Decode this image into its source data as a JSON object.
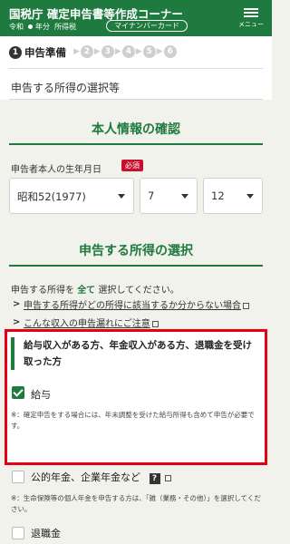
{
  "header": {
    "title": "国税庁 確定申告書等作成コーナー",
    "era": "令和",
    "year_suffix": "年分",
    "tax_type": "所得税",
    "mynumber_button": "マイナンバーカード",
    "menu_label": "メニュー"
  },
  "steps": {
    "current_number": "1",
    "current_label": "申告準備",
    "pending": [
      "2",
      "3",
      "4",
      "5",
      "6"
    ]
  },
  "page_heading": "申告する所得の選択等",
  "personal": {
    "section_title": "本人情報の確認",
    "birth_label": "申告者本人の生年月日",
    "required_badge": "必須",
    "birth_year": "昭和52(1977)",
    "birth_month": "7",
    "birth_day": "12"
  },
  "income": {
    "section_title": "申告する所得の選択",
    "intro_before": "申告する所得を",
    "intro_bold": "全て",
    "intro_after": "選択してください。",
    "link1": "申告する所得がどの所得に該当するか分からない場合",
    "link2": "こんな収入の申告漏れにご注意",
    "category_title": "給与収入がある方、年金収入がある方、退職金を受け取った方",
    "options": [
      {
        "label": "給与",
        "checked": true
      },
      {
        "label": "公的年金、企業年金など",
        "checked": false
      },
      {
        "label": "退職金",
        "checked": false
      }
    ],
    "note_salary": "※：確定申告をする場合には、年末調整を受けた給与所得も含めて申告が必要です。",
    "note_pension": "※：生命保険等の個人年金を申告する方は、「雑（業務・その他）」を選択してください。",
    "help_mark": "?"
  },
  "colors": {
    "brand_green": "#1f7a3f",
    "highlight_red": "#e60012",
    "badge_red": "#c8102e"
  }
}
